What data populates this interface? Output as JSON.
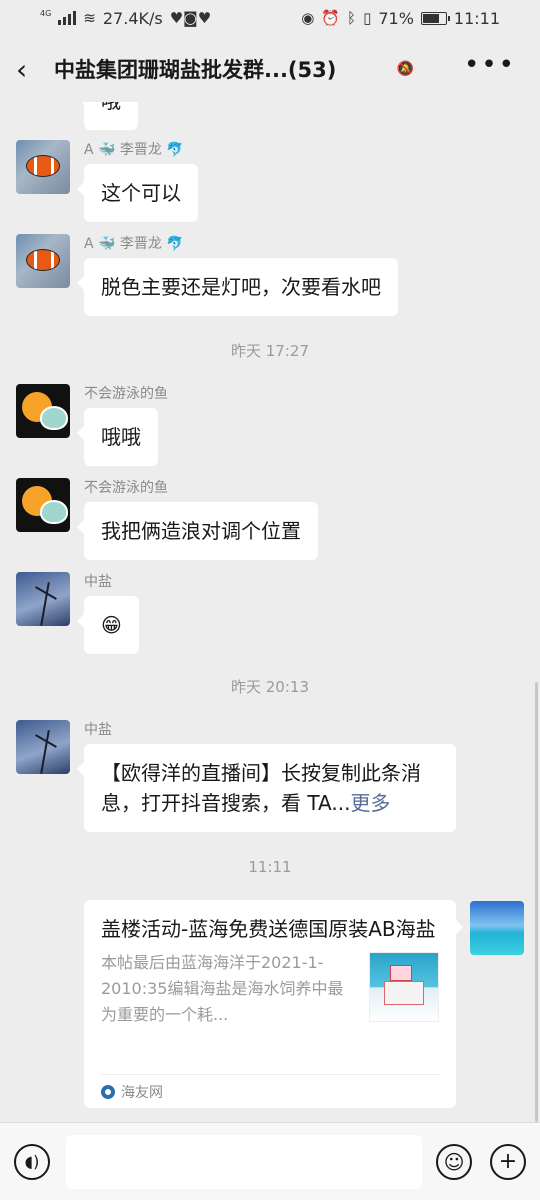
{
  "status_bar": {
    "network_tag": "4G",
    "speed": "27.4K/s",
    "health_icons": "♥◙♥",
    "battery": "71%",
    "battery_level": 0.71,
    "time": "11:11"
  },
  "header": {
    "back_icon": "‹",
    "title": "中盐集团珊瑚盐批发群...(53)",
    "mute_icon": "bell-off",
    "more_icon": "•••"
  },
  "messages": [
    {
      "sender": "",
      "text": "哦"
    },
    {
      "sender": "A 🐳 李晋龙 🐬",
      "text": "这个可以"
    },
    {
      "sender": "A 🐳 李晋龙 🐬",
      "text": "脱色主要还是灯吧，次要看水吧"
    },
    {
      "sender": "不会游泳的鱼",
      "text": "哦哦"
    },
    {
      "sender": "不会游泳的鱼",
      "text": "我把俩造浪对调个位置"
    },
    {
      "sender": "中盐",
      "text": "😁"
    },
    {
      "sender": "中盐",
      "text": "【欧得洋的直播间】长按复制此条消息，打开抖音搜索，看 TA...",
      "more": "更多"
    }
  ],
  "timestamps": [
    "昨天 17:27",
    "昨天 20:13",
    "11:11"
  ],
  "link_card": {
    "title": "盖楼活动-蓝海免费送德国原装AB海盐",
    "description": "本帖最后由蓝海海洋于2021-1-2010:35编辑海盐是海水饲养中最为重要的一个耗...",
    "source": "海友网"
  },
  "input_bar": {
    "voice_icon": "voice-icon",
    "emoji_icon": "emoji-icon",
    "plus_icon": "plus-icon"
  }
}
